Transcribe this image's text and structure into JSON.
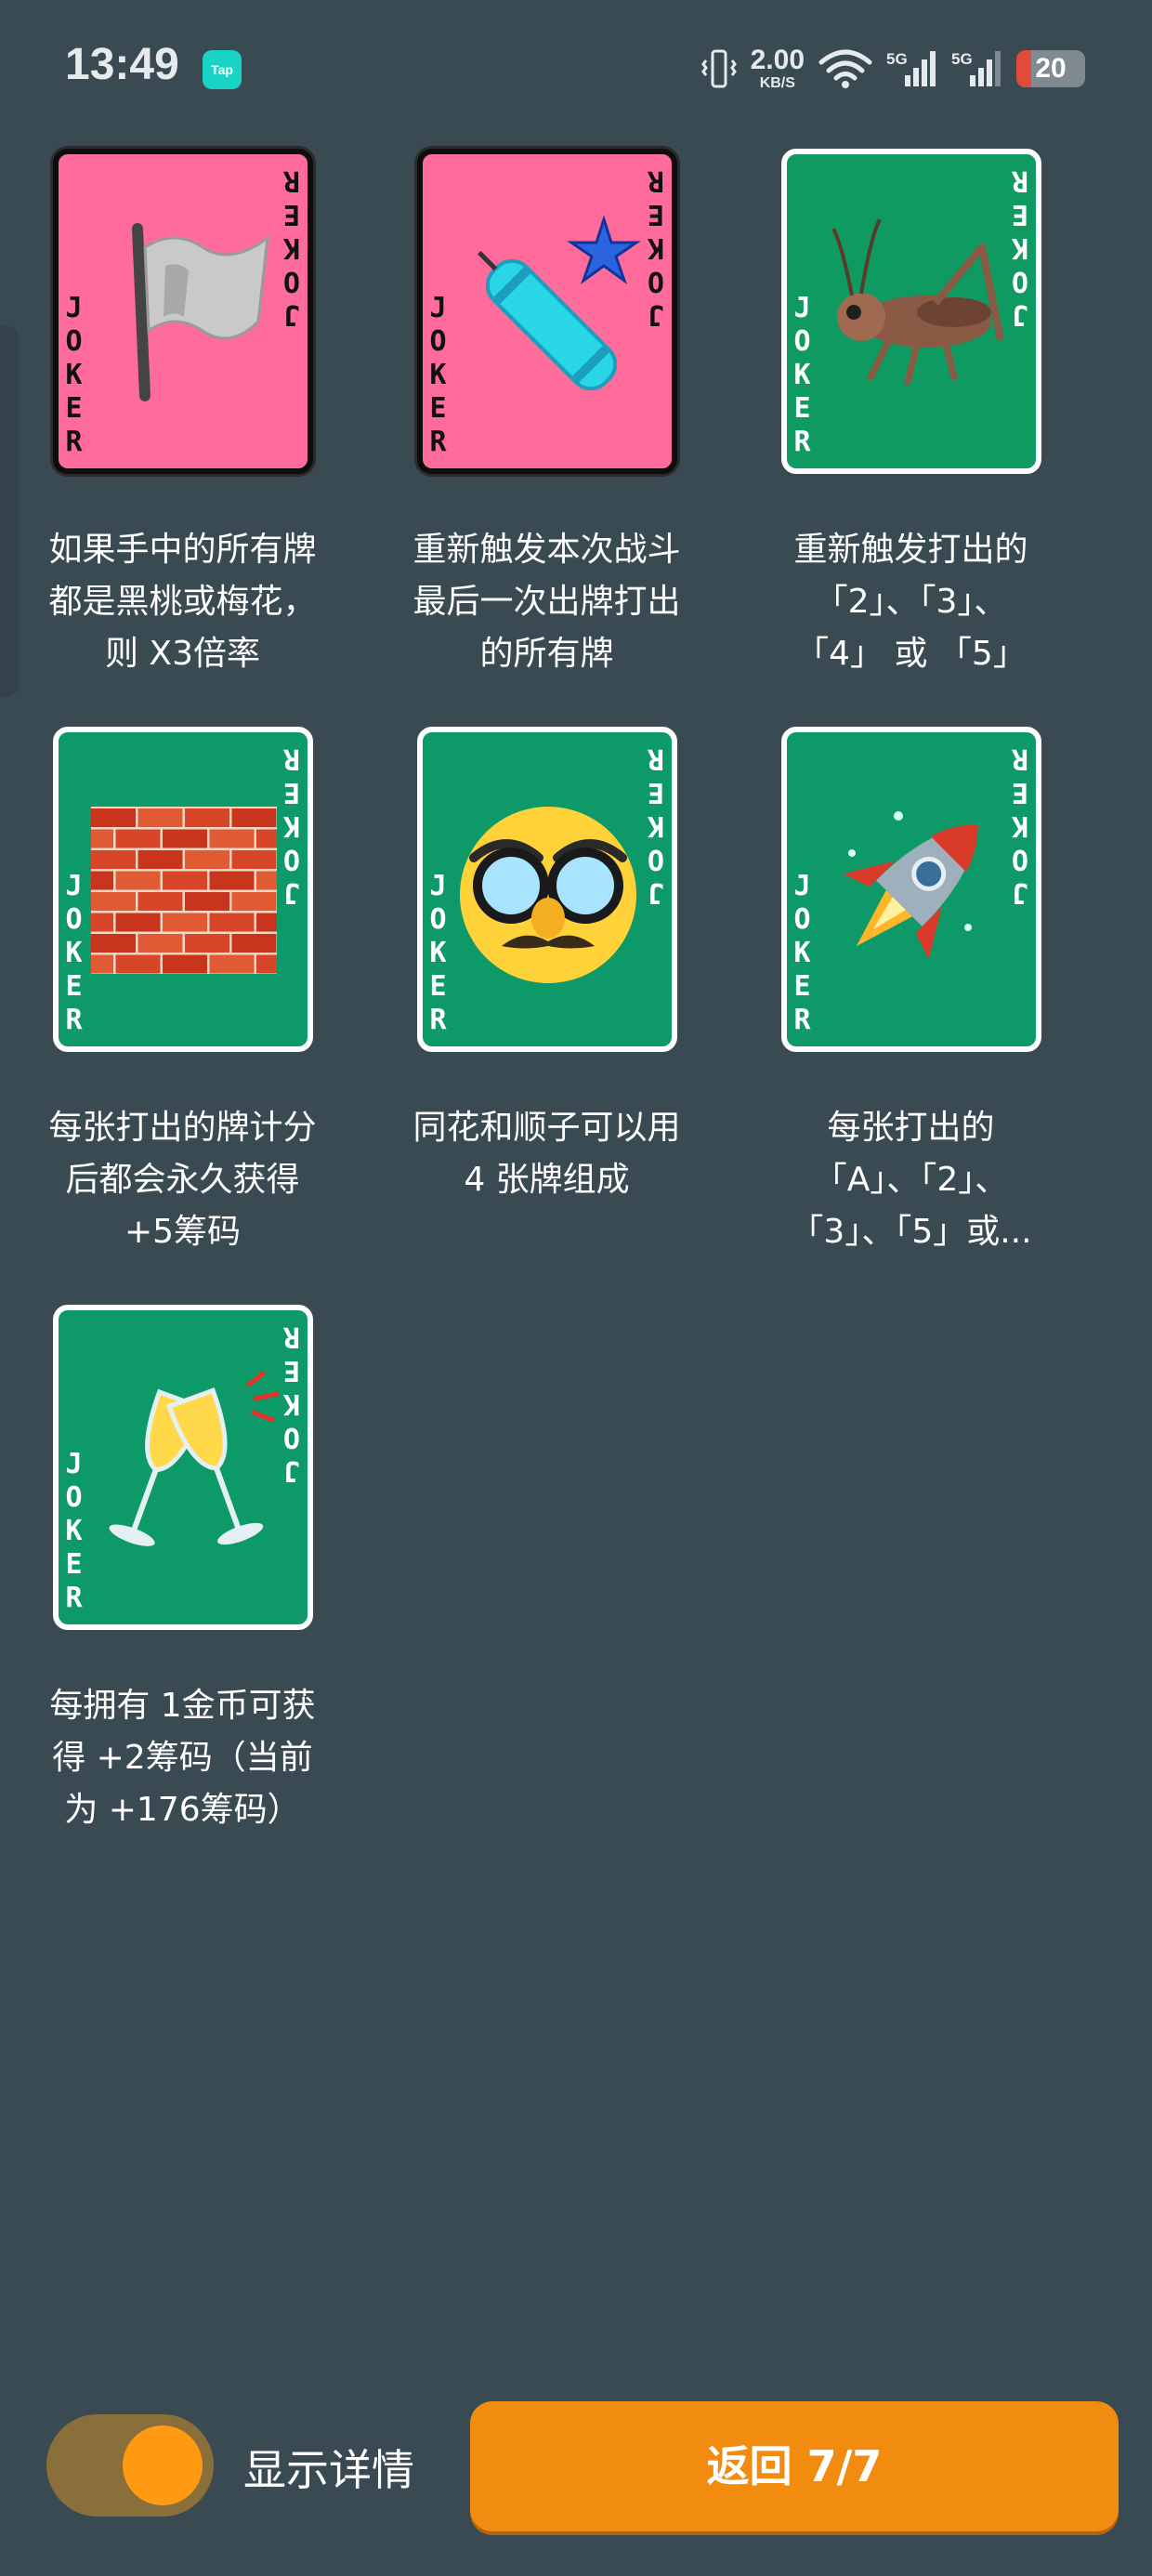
{
  "status_bar": {
    "time": "13:49",
    "app_badge": "Tap",
    "net_speed_value": "2.00",
    "net_speed_unit": "KB/S",
    "signal1_label": "5G",
    "signal2_label": "5G",
    "battery_level": "20"
  },
  "cards": [
    {
      "border": "dark",
      "bg": "#ff6b9a",
      "letter_color": "#111111",
      "art": "white-flag-icon",
      "caption": [
        "如果手中的所有牌",
        "都是黑桃或梅花，",
        "则 X3倍率"
      ]
    },
    {
      "border": "dark",
      "bg": "#ff6b9a",
      "letter_color": "#111111",
      "art": "firecracker-icon",
      "caption": [
        "重新触发本次战斗",
        "最后一次出牌打出",
        "的所有牌"
      ]
    },
    {
      "border": "light",
      "bg": "#0f9a62",
      "letter_color": "#ffffff",
      "art": "cricket-icon",
      "caption": [
        "重新触发打出的",
        "「2」、「3」、",
        "「4」 或 「5」"
      ]
    },
    {
      "border": "light",
      "bg": "#0e9a68",
      "letter_color": "#ffffff",
      "art": "brick-wall-icon",
      "caption": [
        "每张打出的牌计分",
        "后都会永久获得",
        "+5筹码"
      ]
    },
    {
      "border": "light",
      "bg": "#0e9a68",
      "letter_color": "#ffffff",
      "art": "disguised-face-icon",
      "caption": [
        "同花和顺子可以用",
        "4 张牌组成"
      ]
    },
    {
      "border": "light",
      "bg": "#0e9a68",
      "letter_color": "#ffffff",
      "art": "rocket-icon",
      "caption": [
        "每张打出的",
        "「A」、「2」、",
        "「3」、「5」或..."
      ]
    },
    {
      "border": "light",
      "bg": "#0e9a68",
      "letter_color": "#ffffff",
      "art": "clinking-glasses-icon",
      "caption": [
        "每拥有 1金币可获",
        "得 +2筹码（当前",
        "为 +176筹码）"
      ]
    }
  ],
  "card_word": "JOKER",
  "bottom": {
    "toggle_label": "显示详情",
    "toggle_on": true,
    "back_button": "返回 7/7"
  }
}
